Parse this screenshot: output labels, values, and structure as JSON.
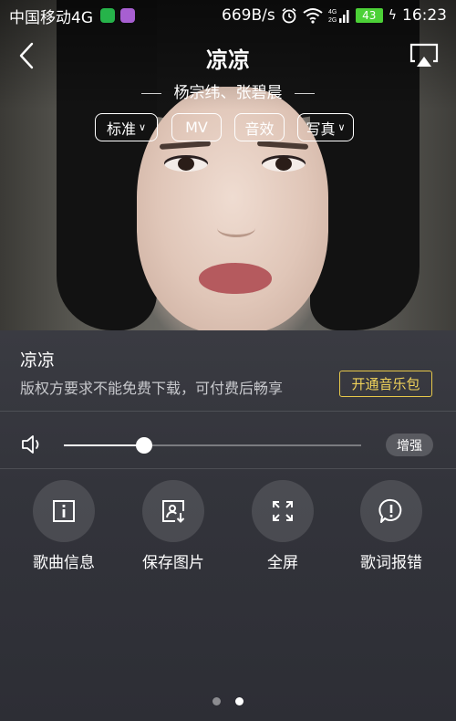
{
  "status_bar": {
    "carrier": "中国移动4G",
    "speed": "669B/s",
    "network_badge": "4G\n2G",
    "battery": "43",
    "time": "16:23"
  },
  "header": {
    "title": "凉凉",
    "artists": "杨宗纬、张碧晨",
    "chips": {
      "quality": "标准",
      "mv": "MV",
      "effect": "音效",
      "photo": "写真"
    }
  },
  "info": {
    "song_name": "凉凉",
    "copyright_notice": "版权方要求不能免费下载，可付费后畅享",
    "vip_button": "开通音乐包"
  },
  "volume": {
    "level": 0.27,
    "boost_label": "增强"
  },
  "actions": [
    {
      "label": "歌曲信息",
      "icon": "info-icon"
    },
    {
      "label": "保存图片",
      "icon": "save-image-icon"
    },
    {
      "label": "全屏",
      "icon": "fullscreen-icon"
    },
    {
      "label": "歌词报错",
      "icon": "report-lyrics-icon"
    }
  ],
  "pager": {
    "total": 2,
    "active": 1
  },
  "colors": {
    "vip_accent": "#f0d25a",
    "panel_bg": "#33343b"
  }
}
